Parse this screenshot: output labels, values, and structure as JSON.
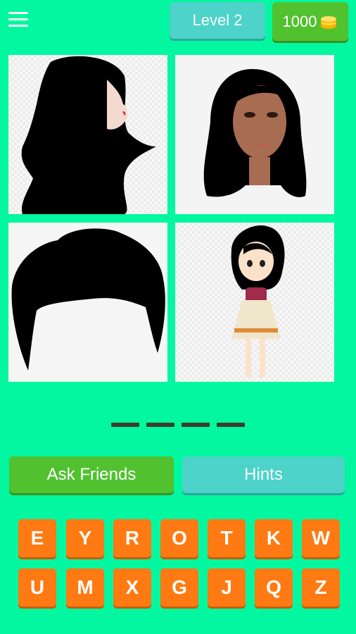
{
  "header": {
    "level_label": "Level 2",
    "coins": "1000"
  },
  "images": [
    {
      "name": "hair-profile-silhouette"
    },
    {
      "name": "woman-face-black-hair"
    },
    {
      "name": "hair-wig-silhouette"
    },
    {
      "name": "cartoon-girl-dark-hair"
    }
  ],
  "answer": {
    "length": 4
  },
  "buttons": {
    "ask_friends": "Ask Friends",
    "hints": "Hints"
  },
  "keyboard": {
    "row1": [
      "E",
      "Y",
      "R",
      "O",
      "T",
      "K",
      "W"
    ],
    "row2": [
      "U",
      "M",
      "X",
      "G",
      "J",
      "Q",
      "Z"
    ]
  },
  "colors": {
    "background": "#02f7a0",
    "green": "#52c12f",
    "teal": "#4dd3c9",
    "orange": "#ff7a12"
  }
}
